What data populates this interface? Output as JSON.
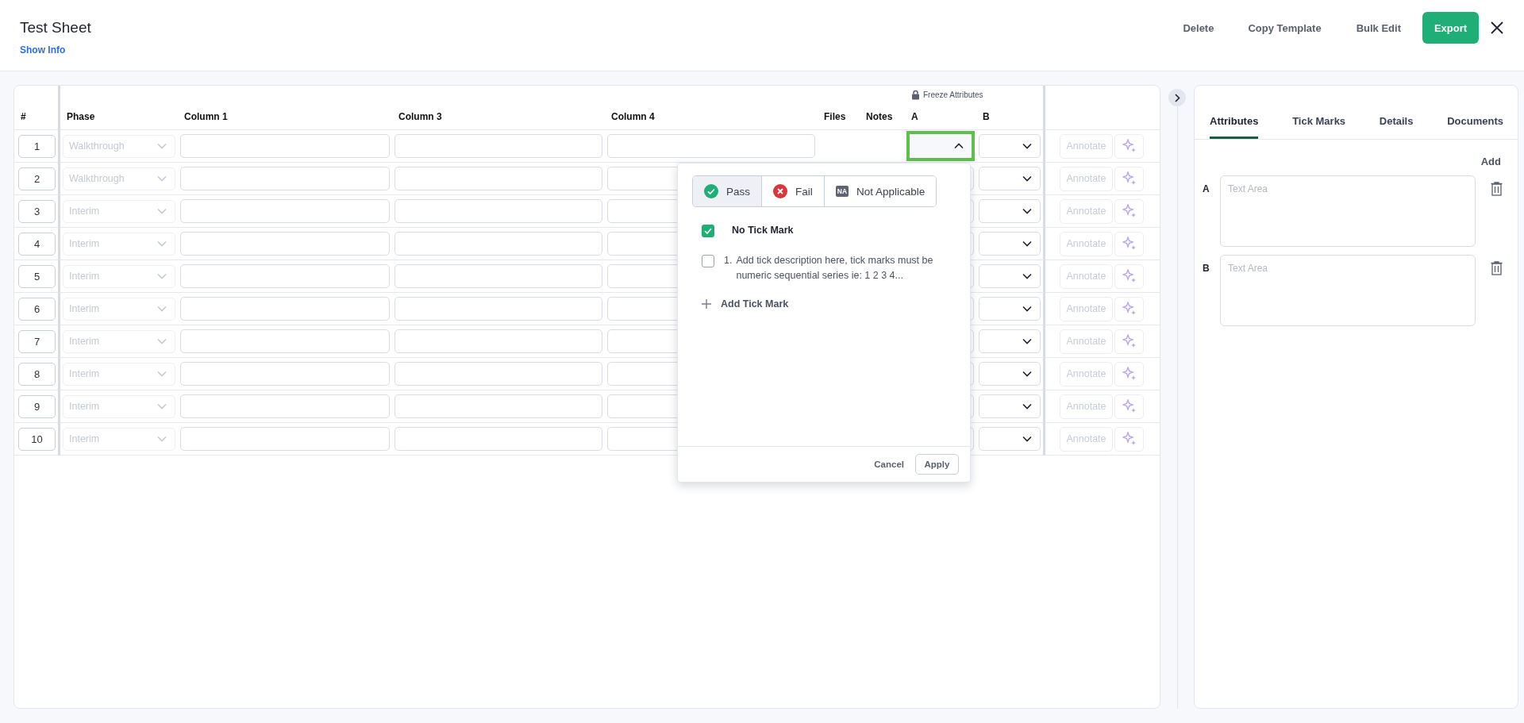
{
  "header": {
    "title": "Test Sheet",
    "show_info": "Show Info",
    "actions": [
      "Delete",
      "Copy Template",
      "Bulk Edit"
    ],
    "export": "Export"
  },
  "table": {
    "columns": [
      "#",
      "Phase",
      "Column 1",
      "Column 3",
      "Column 4",
      "Files",
      "Notes",
      "A",
      "B"
    ],
    "freeze": "Freeze Attributes",
    "rows": [
      {
        "number": "1",
        "phase": "Walkthrough",
        "annotate": "Annotate",
        "a_open": true
      },
      {
        "number": "2",
        "phase": "Walkthrough",
        "annotate": "Annotate",
        "a_open": false
      },
      {
        "number": "3",
        "phase": "Interim",
        "annotate": "Annotate",
        "a_open": false
      },
      {
        "number": "4",
        "phase": "Interim",
        "annotate": "Annotate",
        "a_open": false
      },
      {
        "number": "5",
        "phase": "Interim",
        "annotate": "Annotate",
        "a_open": false
      },
      {
        "number": "6",
        "phase": "Interim",
        "annotate": "Annotate",
        "a_open": false
      },
      {
        "number": "7",
        "phase": "Interim",
        "annotate": "Annotate",
        "a_open": false
      },
      {
        "number": "8",
        "phase": "Interim",
        "annotate": "Annotate",
        "a_open": false
      },
      {
        "number": "9",
        "phase": "Interim",
        "annotate": "Annotate",
        "a_open": false
      },
      {
        "number": "10",
        "phase": "Interim",
        "annotate": "Annotate",
        "a_open": false
      }
    ]
  },
  "popup": {
    "results": [
      {
        "kind": "pass",
        "label": "Pass",
        "selected": true
      },
      {
        "kind": "fail",
        "label": "Fail",
        "selected": false
      },
      {
        "kind": "na",
        "badge": "NA",
        "label": "Not Applicable",
        "selected": false
      }
    ],
    "tick_marks": [
      {
        "kind": "none",
        "label": "No Tick Mark",
        "checked": true
      },
      {
        "kind": "numbered",
        "number": "1.",
        "label": "Add tick description here, tick marks must be numeric sequential series ie: 1 2 3 4...",
        "checked": false
      }
    ],
    "add": "Add Tick Mark",
    "cancel": "Cancel",
    "apply": "Apply"
  },
  "side_panel": {
    "tabs": [
      {
        "label": "Attributes",
        "selected": true
      },
      {
        "label": "Tick Marks",
        "selected": false
      },
      {
        "label": "Details",
        "selected": false
      },
      {
        "label": "Documents",
        "selected": false
      }
    ],
    "add": "Add",
    "attributes": [
      {
        "label": "A",
        "placeholder": "Text Area"
      },
      {
        "label": "B",
        "placeholder": "Text Area"
      }
    ]
  }
}
